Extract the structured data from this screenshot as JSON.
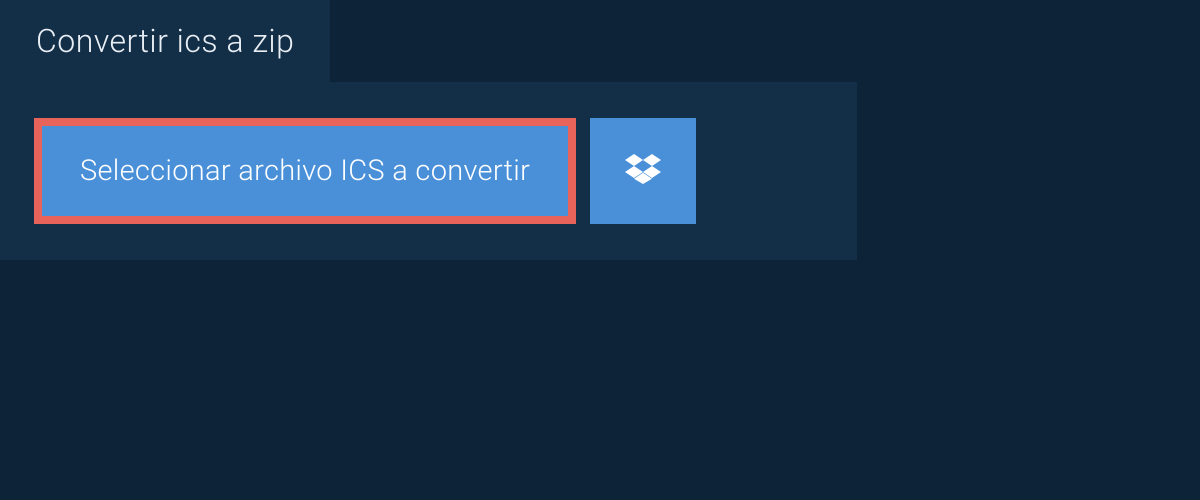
{
  "tab": {
    "label": "Convertir ics a zip"
  },
  "actions": {
    "select_file_label": "Seleccionar archivo ICS a convertir"
  },
  "colors": {
    "background": "#0d2438",
    "panel": "#132e47",
    "button": "#4a90d9",
    "highlight_border": "#e8645a",
    "text_light": "#ffffff"
  }
}
